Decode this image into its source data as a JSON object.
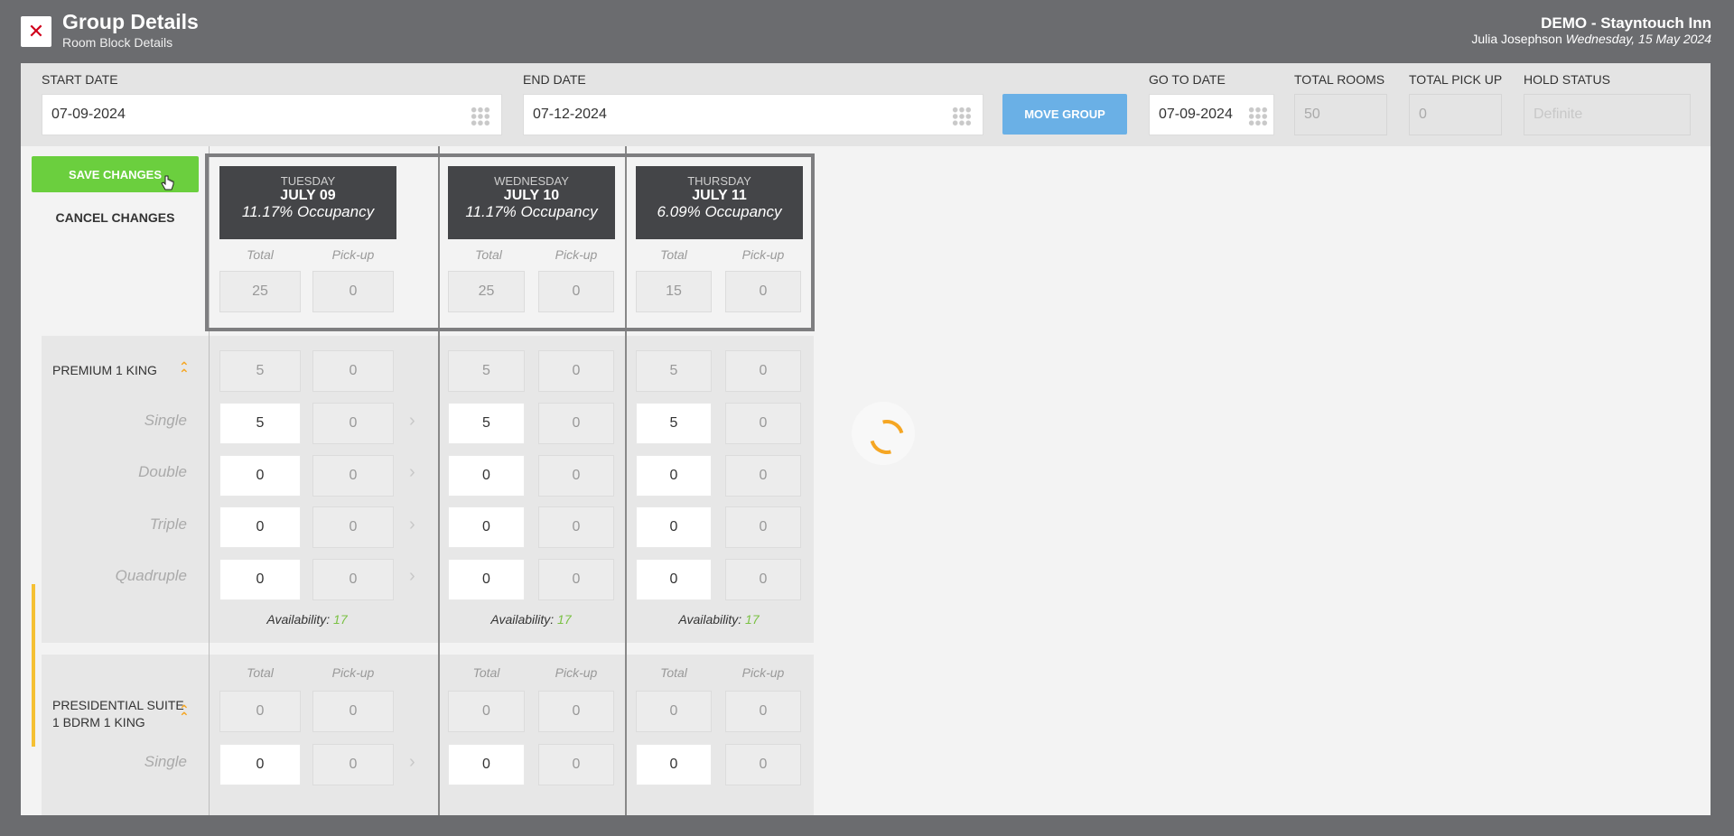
{
  "header": {
    "close_label": "✕",
    "title": "Group Details",
    "subtitle": "Room Block Details",
    "hotel": "DEMO - Stayntouch Inn",
    "user": "Julia Josephson",
    "date": "Wednesday, 15 May 2024"
  },
  "filters": {
    "start_date_label": "START DATE",
    "start_date": "07-09-2024",
    "end_date_label": "END DATE",
    "end_date": "07-12-2024",
    "move_group_label": "MOVE GROUP",
    "go_to_date_label": "GO TO DATE",
    "go_to_date": "07-09-2024",
    "total_rooms_label": "TOTAL ROOMS",
    "total_rooms": "50",
    "total_pickup_label": "TOTAL PICK UP",
    "total_pickup": "0",
    "hold_status_label": "HOLD STATUS",
    "hold_status": "Definite"
  },
  "actions": {
    "save_label": "SAVE CHANGES",
    "cancel_label": "CANCEL CHANGES"
  },
  "columns": {
    "total_label": "Total",
    "pickup_label": "Pick-up"
  },
  "days": [
    {
      "weekday": "TUESDAY",
      "date": "JULY 09",
      "occupancy": "11.17% Occupancy",
      "total": "25",
      "pickup": "0"
    },
    {
      "weekday": "WEDNESDAY",
      "date": "JULY 10",
      "occupancy": "11.17% Occupancy",
      "total": "25",
      "pickup": "0"
    },
    {
      "weekday": "THURSDAY",
      "date": "JULY 11",
      "occupancy": "6.09% Occupancy",
      "total": "15",
      "pickup": "0"
    }
  ],
  "room_types": [
    {
      "name": "PREMIUM 1 KING",
      "totals": [
        [
          "5",
          "0"
        ],
        [
          "5",
          "0"
        ],
        [
          "5",
          "0"
        ]
      ],
      "occupancy_rows": [
        {
          "label": "Single",
          "values": [
            [
              "5",
              "0"
            ],
            [
              "5",
              "0"
            ],
            [
              "5",
              "0"
            ]
          ]
        },
        {
          "label": "Double",
          "values": [
            [
              "0",
              "0"
            ],
            [
              "0",
              "0"
            ],
            [
              "0",
              "0"
            ]
          ]
        },
        {
          "label": "Triple",
          "values": [
            [
              "0",
              "0"
            ],
            [
              "0",
              "0"
            ],
            [
              "0",
              "0"
            ]
          ]
        },
        {
          "label": "Quadruple",
          "values": [
            [
              "0",
              "0"
            ],
            [
              "0",
              "0"
            ],
            [
              "0",
              "0"
            ]
          ]
        }
      ],
      "availability_label": "Availability:",
      "availability": [
        "17",
        "17",
        "17"
      ]
    },
    {
      "name_line1": "PRESIDENTIAL SUITE",
      "name_line2": "1 BDRM 1 KING",
      "totals": [
        [
          "0",
          "0"
        ],
        [
          "0",
          "0"
        ],
        [
          "0",
          "0"
        ]
      ],
      "occupancy_rows": [
        {
          "label": "Single",
          "values": [
            [
              "0",
              "0"
            ],
            [
              "0",
              "0"
            ],
            [
              "0",
              "0"
            ]
          ]
        }
      ]
    }
  ]
}
